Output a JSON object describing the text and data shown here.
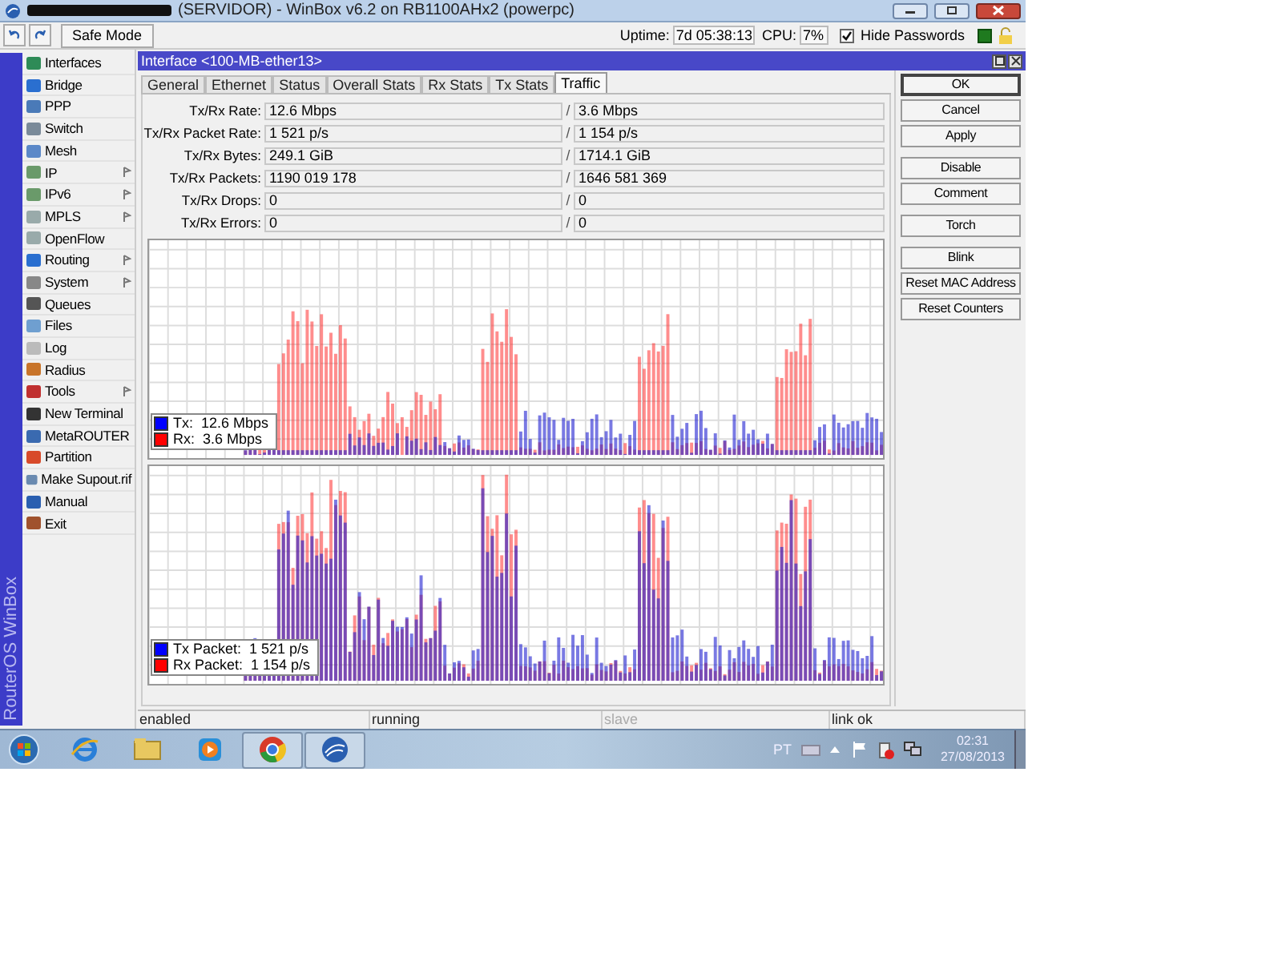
{
  "window": {
    "title": "(SERVIDOR) - WinBox v6.2 on RB1100AHx2 (powerpc)"
  },
  "toolbar": {
    "safe_mode": "Safe Mode",
    "uptime_label": "Uptime:",
    "uptime": "7d 05:38:13",
    "cpu_label": "CPU:",
    "cpu": "7%",
    "hide_passwords": {
      "label": "Hide Passwords",
      "checked": true
    }
  },
  "sidebar": {
    "brand": "RouterOS WinBox",
    "items": [
      {
        "label": "Interfaces",
        "has_submenu": false
      },
      {
        "label": "Bridge",
        "has_submenu": false
      },
      {
        "label": "PPP",
        "has_submenu": false
      },
      {
        "label": "Switch",
        "has_submenu": false
      },
      {
        "label": "Mesh",
        "has_submenu": false
      },
      {
        "label": "IP",
        "has_submenu": true
      },
      {
        "label": "IPv6",
        "has_submenu": true
      },
      {
        "label": "MPLS",
        "has_submenu": true
      },
      {
        "label": "OpenFlow",
        "has_submenu": false
      },
      {
        "label": "Routing",
        "has_submenu": true
      },
      {
        "label": "System",
        "has_submenu": true
      },
      {
        "label": "Queues",
        "has_submenu": false
      },
      {
        "label": "Files",
        "has_submenu": false
      },
      {
        "label": "Log",
        "has_submenu": false
      },
      {
        "label": "Radius",
        "has_submenu": false
      },
      {
        "label": "Tools",
        "has_submenu": true
      },
      {
        "label": "New Terminal",
        "has_submenu": false
      },
      {
        "label": "MetaROUTER",
        "has_submenu": false
      },
      {
        "label": "Partition",
        "has_submenu": false
      },
      {
        "label": "Make Supout.rif",
        "has_submenu": false
      },
      {
        "label": "Manual",
        "has_submenu": false
      },
      {
        "label": "Exit",
        "has_submenu": false
      }
    ]
  },
  "interface_window": {
    "title": "Interface <100-MB-ether13>",
    "tabs": [
      {
        "label": "General",
        "selected": false
      },
      {
        "label": "Ethernet",
        "selected": false
      },
      {
        "label": "Status",
        "selected": false
      },
      {
        "label": "Overall Stats",
        "selected": false
      },
      {
        "label": "Rx Stats",
        "selected": false
      },
      {
        "label": "Tx Stats",
        "selected": false
      },
      {
        "label": "Traffic",
        "selected": true
      }
    ],
    "fields": [
      {
        "label": "Tx/Rx Rate:",
        "tx": "12.6 Mbps",
        "sep": "/",
        "rx": "3.6 Mbps"
      },
      {
        "label": "Tx/Rx Packet Rate:",
        "tx": "1 521 p/s",
        "sep": "/",
        "rx": "1 154 p/s"
      },
      {
        "label": "Tx/Rx Bytes:",
        "tx": "249.1 GiB",
        "sep": "/",
        "rx": "1714.1 GiB"
      },
      {
        "label": "Tx/Rx Packets:",
        "tx": "1190 019 178",
        "sep": "/",
        "rx": "1646 581 369"
      },
      {
        "label": "Tx/Rx Drops:",
        "tx": "0",
        "sep": "/",
        "rx": "0"
      },
      {
        "label": "Tx/Rx Errors:",
        "tx": "0",
        "sep": "/",
        "rx": "0"
      }
    ],
    "graphs": [
      {
        "legend": [
          {
            "label": "Tx:  12.6 Mbps",
            "color": "#0000ff"
          },
          {
            "label": "Rx:  3.6 Mbps",
            "color": "#ff0000"
          }
        ]
      },
      {
        "legend": [
          {
            "label": "Tx Packet:  1 521 p/s",
            "color": "#0000ff"
          },
          {
            "label": "Rx Packet:  1 154 p/s",
            "color": "#ff0000"
          }
        ]
      }
    ],
    "buttons": [
      {
        "label": "OK",
        "default": true
      },
      {
        "label": "Cancel",
        "default": false
      },
      {
        "label": "Apply",
        "default": false
      },
      {
        "label": "Disable",
        "default": false
      },
      {
        "label": "Comment",
        "default": false
      },
      {
        "label": "Torch",
        "default": false
      },
      {
        "label": "Blink",
        "default": false
      },
      {
        "label": "Reset MAC Address",
        "default": false
      },
      {
        "label": "Reset Counters",
        "default": false
      }
    ],
    "status_bar": [
      {
        "text": "enabled",
        "disabled": false
      },
      {
        "text": "running",
        "disabled": false
      },
      {
        "text": "slave",
        "disabled": true
      },
      {
        "text": "link ok",
        "disabled": false
      }
    ]
  },
  "taskbar": {
    "apps": [
      {
        "kind": "browser",
        "active": false
      },
      {
        "kind": "folder",
        "active": false
      },
      {
        "kind": "player",
        "active": false
      },
      {
        "kind": "chrome",
        "active": true
      },
      {
        "kind": "winbox",
        "active": true
      }
    ],
    "tray": {
      "language": "PT",
      "time": "02:31",
      "date": "27/08/2013"
    }
  }
}
